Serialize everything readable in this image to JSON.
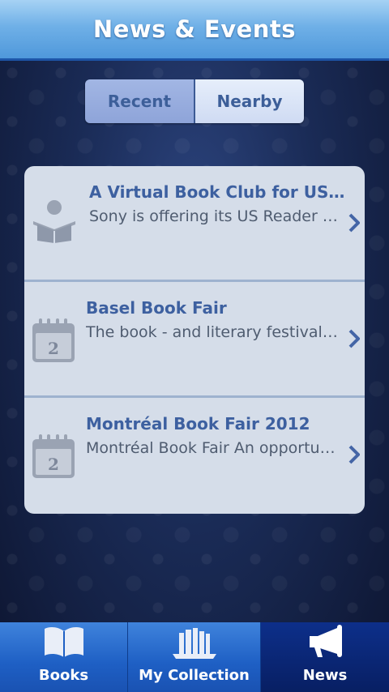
{
  "header": {
    "title": "News & Events"
  },
  "segment": {
    "recent_label": "Recent",
    "nearby_label": "Nearby",
    "selected": "Recent"
  },
  "items": [
    {
      "title": "A Virtual Book Club for US Cus...",
      "description": "Sony is offering its US Reader St...",
      "icon": "reader-icon"
    },
    {
      "title": "Basel Book Fair",
      "description": "The book - and literary festival B...",
      "icon": "calendar-icon",
      "icon_day": "2"
    },
    {
      "title": "Montréal Book Fair 2012",
      "description": "Montréal Book Fair An opportuni...",
      "icon": "calendar-icon",
      "icon_day": "2"
    }
  ],
  "tabs": [
    {
      "label": "Books",
      "icon": "open-book-icon"
    },
    {
      "label": "My Collection",
      "icon": "bookshelf-icon"
    },
    {
      "label": "News",
      "icon": "megaphone-icon",
      "active": true
    }
  ],
  "colors": {
    "header_top": "#a6d2f4",
    "header_bottom": "#4f98db",
    "title_blue": "#3d60a0",
    "list_bg": "#d5dde9",
    "tab_active": "#081f63"
  }
}
